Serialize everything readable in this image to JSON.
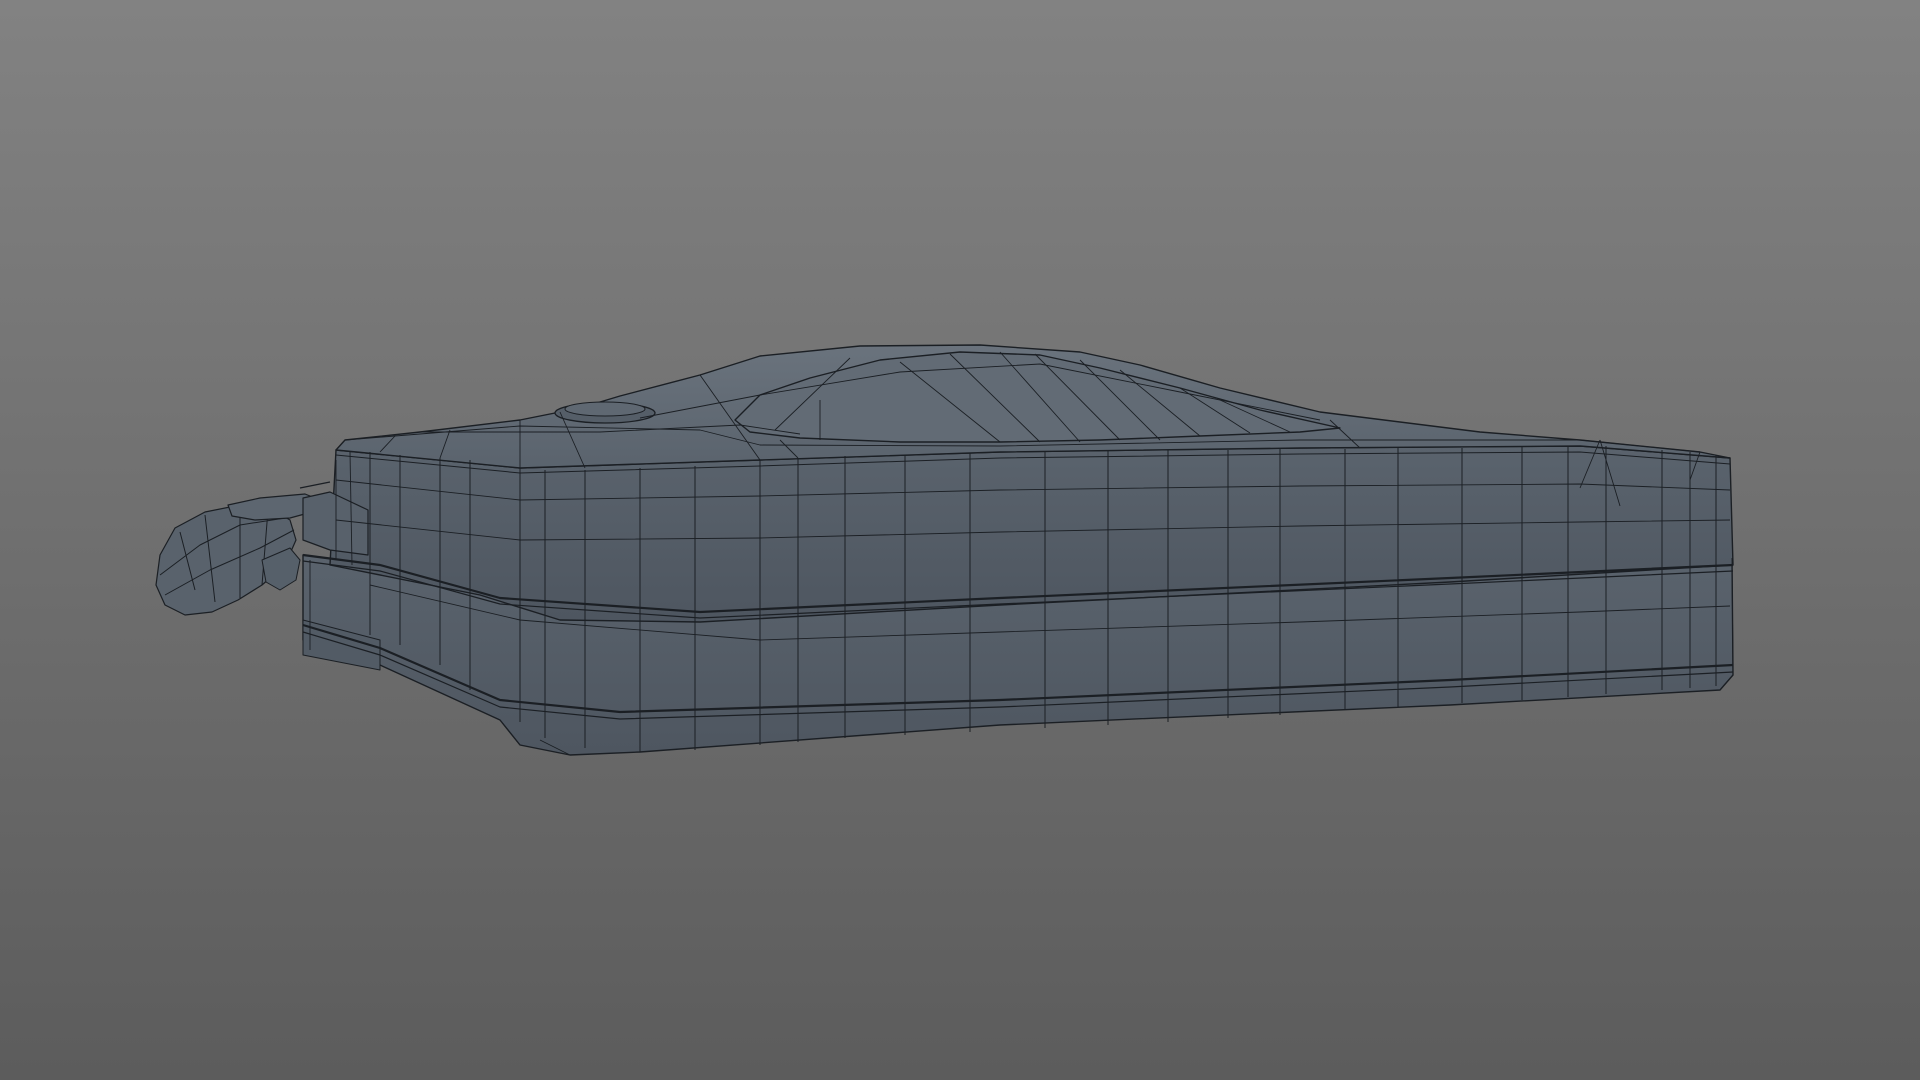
{
  "viewport": {
    "background_top": "#828282",
    "background_bottom": "#5c5c5c",
    "shading_mode": "wireframe-on-shaded"
  },
  "model": {
    "shape": "console-body",
    "surface_color": "#5a636d",
    "surface_shadow_color": "#4e5660",
    "surface_highlight_color": "#6a737d",
    "wire_color": "#1b1f24"
  }
}
